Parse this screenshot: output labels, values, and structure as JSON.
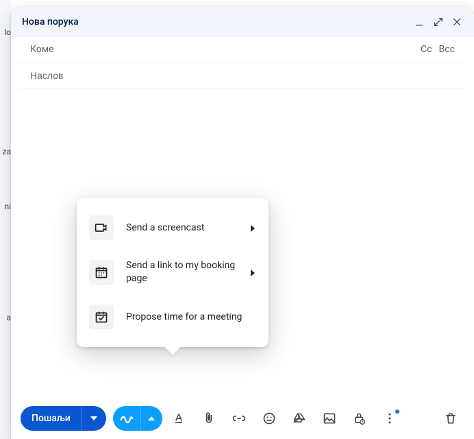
{
  "bg_fragments": [
    "lo",
    "za",
    "ni",
    "a"
  ],
  "header": {
    "title": "Нова порука"
  },
  "recipients": {
    "label": "Коме",
    "cc": "Cc",
    "bcc": "Bcc"
  },
  "subject": {
    "placeholder": "Наслов",
    "value": ""
  },
  "toolbar": {
    "send": "Пошаљи"
  },
  "popup": {
    "items": [
      {
        "id": "screencast",
        "label": "Send a screencast",
        "has_submenu": true
      },
      {
        "id": "booking",
        "label": "Send a link to my booking page",
        "has_submenu": true
      },
      {
        "id": "propose",
        "label": "Propose time for a meeting",
        "has_submenu": false
      }
    ]
  }
}
